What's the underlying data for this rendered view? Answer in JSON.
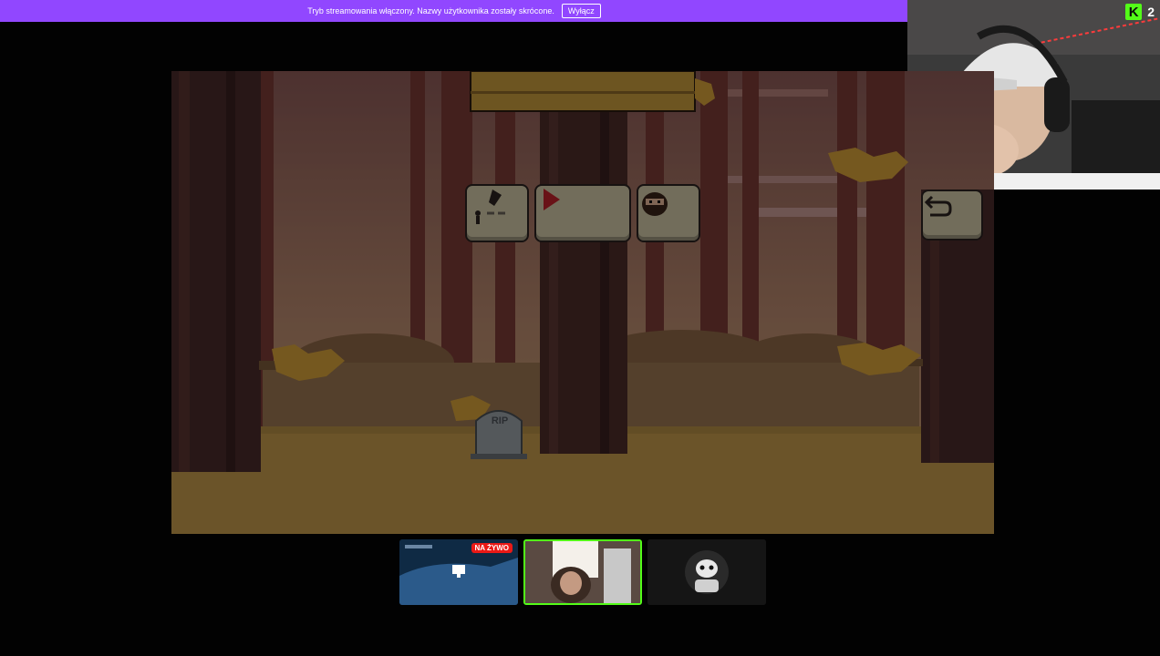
{
  "banner": {
    "text": "Tryb streamowania włączony. Nazwy użytkownika zostały skrócone.",
    "button_label": "Wyłącz"
  },
  "webcam": {
    "viewer_count": "2"
  },
  "game": {
    "tombstone_text": "RIP",
    "buttons": [
      "settings",
      "play",
      "character",
      "back"
    ]
  },
  "thumbnails": [
    {
      "label": "stream-preview",
      "badge": "NA ŻYWO"
    },
    {
      "label": "webcam-preview"
    },
    {
      "label": "avatar-preview"
    }
  ],
  "colors": {
    "banner": "#9147ff",
    "kick_green": "#53fc18",
    "live_red": "#e91916"
  }
}
